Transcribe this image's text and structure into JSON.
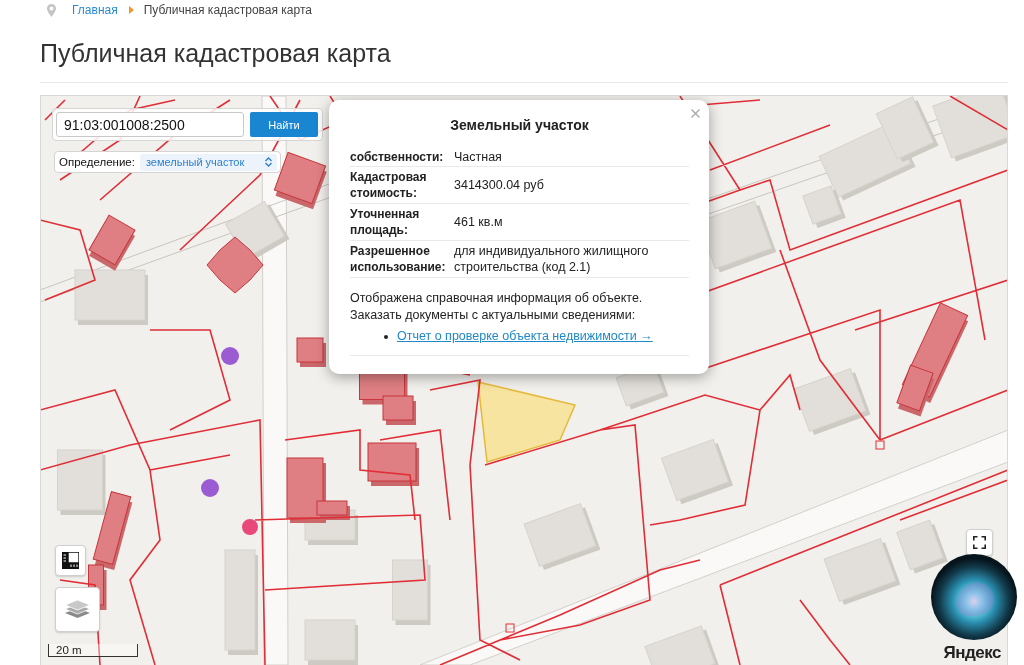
{
  "breadcrumb": [
    {
      "kind": "link",
      "label": "Главная"
    },
    {
      "kind": "current",
      "label": "Публичная кадастровая карта"
    }
  ],
  "title": "Публичная кадастровая карта",
  "map": {
    "search": {
      "value": "91:03:001008:2500",
      "button": "Найти"
    },
    "definition": {
      "label": "Определение:",
      "value": "земельный участок"
    },
    "popup": {
      "title": "Земельный участок",
      "rows": [
        {
          "label": "собственности:",
          "value": "Частная"
        },
        {
          "label": "Кадастровая стоимость:",
          "value": "3414300.04 руб"
        },
        {
          "label": "Уточненная площадь:",
          "value": "461 кв.м"
        },
        {
          "label": "Разрешенное использование:",
          "value": "для индивидуального жилищного строительства (код 2.1)"
        }
      ],
      "note": [
        "Отображена справочная информация об объекте.",
        "Заказать документы с актуальными сведениями:"
      ],
      "links": [
        "Отчет о проверке объекта недвижимости →"
      ]
    },
    "scale": "20 m",
    "logo": "Яндекс"
  }
}
